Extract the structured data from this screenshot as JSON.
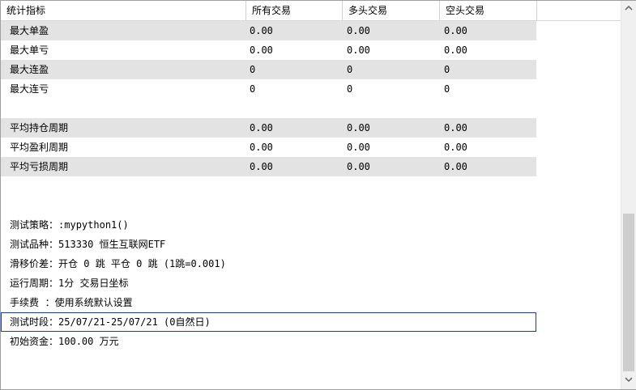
{
  "columns": [
    "统计指标",
    "所有交易",
    "多头交易",
    "空头交易"
  ],
  "rows": [
    {
      "label": "最大单盈",
      "all": "0.00",
      "long": "0.00",
      "short": "0.00"
    },
    {
      "label": "最大单亏",
      "all": "0.00",
      "long": "0.00",
      "short": "0.00"
    },
    {
      "label": "最大连盈",
      "all": "0",
      "long": "0",
      "short": "0"
    },
    {
      "label": "最大连亏",
      "all": "0",
      "long": "0",
      "short": "0"
    },
    {
      "label": "平均持仓周期",
      "all": "0.00",
      "long": "0.00",
      "short": "0.00"
    },
    {
      "label": "平均盈利周期",
      "all": "0.00",
      "long": "0.00",
      "short": "0.00"
    },
    {
      "label": "平均亏损周期",
      "all": "0.00",
      "long": "0.00",
      "short": "0.00"
    }
  ],
  "info": [
    {
      "label": "测试策略：",
      "value": ":mypython1()"
    },
    {
      "label": "测试品种：",
      "value": "513330 恒生互联网ETF"
    },
    {
      "label": "滑移价差：",
      "value": "开仓 0 跳 平仓 0 跳 (1跳=0.001)"
    },
    {
      "label": "运行周期：",
      "value": "1分 交易日坐标"
    },
    {
      "label": "手续费  ：",
      "value": "使用系统默认设置"
    },
    {
      "label": "测试时段：",
      "value": "25/07/21-25/07/21 (0自然日)"
    },
    {
      "label": "初始资金：",
      "value": "100.00 万元"
    }
  ],
  "scrollbar": {
    "up_icon": "chevron-up-icon",
    "down_icon": "chevron-down-icon"
  }
}
